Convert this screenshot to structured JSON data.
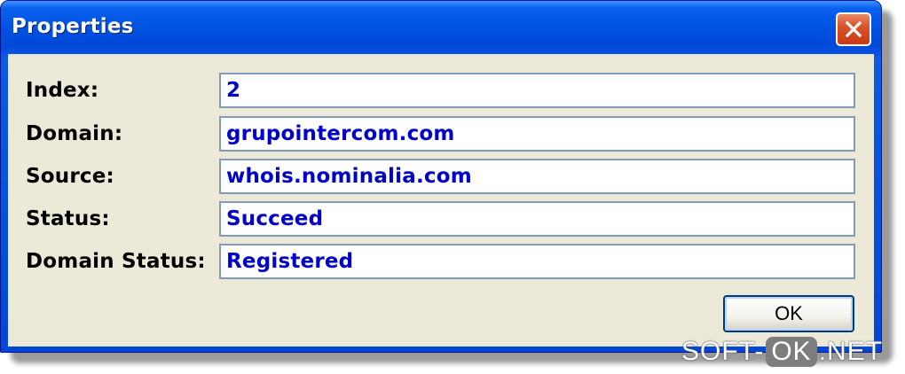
{
  "window": {
    "title": "Properties"
  },
  "fields": [
    {
      "label": "Index:",
      "value": "2"
    },
    {
      "label": "Domain:",
      "value": "grupointercom.com"
    },
    {
      "label": "Source:",
      "value": "whois.nominalia.com"
    },
    {
      "label": "Status:",
      "value": "Succeed"
    },
    {
      "label": "Domain Status:",
      "value": "Registered"
    }
  ],
  "buttons": {
    "ok_label": "OK"
  },
  "watermark": {
    "prefix": "SOFT-",
    "middle": "OK",
    "suffix": ".NET"
  },
  "colors": {
    "titlebar": "#0054e3",
    "client_bg": "#ece9d8",
    "value_text": "#0000c8",
    "field_border": "#7f9db9",
    "close_button": "#d9542c"
  },
  "icons": {
    "close": "close-icon"
  }
}
